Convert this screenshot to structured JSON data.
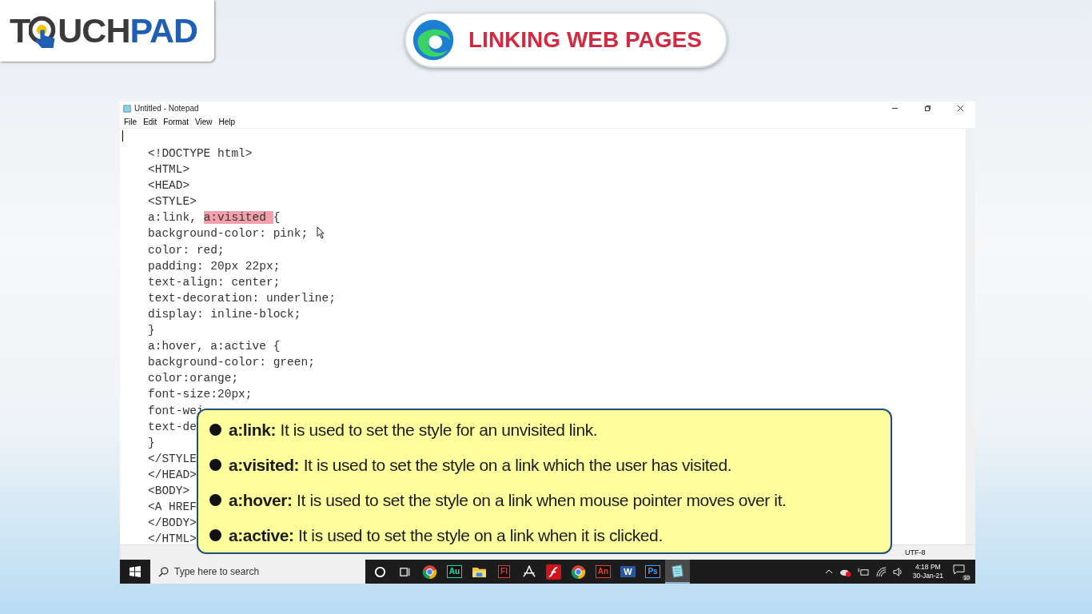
{
  "logo": {
    "start": "T",
    "middle": "UCH",
    "end": "PAD"
  },
  "banner": {
    "title": "LINKING WEB PAGES"
  },
  "window": {
    "title": "Untitled - Notepad",
    "menu": [
      "File",
      "Edit",
      "Format",
      "View",
      "Help"
    ],
    "lines": [
      {
        "text": "<!DOCTYPE html>"
      },
      {
        "text": "<HTML>"
      },
      {
        "text": "<HEAD>"
      },
      {
        "text": "<STYLE>"
      },
      {
        "parts": [
          {
            "text": "a:link, ",
            "selected": false
          },
          {
            "text": "a:visited ",
            "selected": true
          },
          {
            "text": "{",
            "selected": false
          }
        ]
      },
      {
        "text": "background-color: pink;"
      },
      {
        "text": "color: red;"
      },
      {
        "text": "padding: 20px 22px;"
      },
      {
        "text": "text-align: center;"
      },
      {
        "text": "text-decoration: underline;"
      },
      {
        "text": "display: inline-block;"
      },
      {
        "text": "}"
      },
      {
        "text": "a:hover, a:active {"
      },
      {
        "text": "background-color: green;"
      },
      {
        "text": "color:orange;"
      },
      {
        "text": "font-size:20px;"
      },
      {
        "text": "font-wei"
      },
      {
        "text": "text-de"
      },
      {
        "text": "}"
      },
      {
        "text": "</STYLE"
      },
      {
        "text": "</HEAD>"
      },
      {
        "text": "<BODY>"
      },
      {
        "text": "<A HREF"
      },
      {
        "text": "</BODY>"
      },
      {
        "text": "</HTML>"
      }
    ],
    "status": "UTF-8"
  },
  "callout": {
    "items": [
      {
        "text": "**a:link:** It is used to set the style for an unvisited link."
      },
      {
        "text": "**a:visited:** It is used to set the style on a link which the user has visited."
      },
      {
        "text": "**a:hover:** It is used to set the style on a link when mouse pointer moves over it."
      },
      {
        "text": "**a:active:** It is used to set the style on a link when it is clicked."
      }
    ]
  },
  "taskbar": {
    "search_placeholder": "Type here to search",
    "apps": [
      {
        "kind": "cortana",
        "selected": false
      },
      {
        "kind": "taskview",
        "selected": false
      },
      {
        "kind": "chrome",
        "selected": false
      },
      {
        "kind": "badge",
        "label": "Au",
        "color": "#00e4bb",
        "selected": false
      },
      {
        "kind": "folder",
        "selected": false
      },
      {
        "kind": "badge",
        "label": "Fl",
        "color": "#e03a3a",
        "selected": false
      },
      {
        "kind": "acrobat",
        "selected": false
      },
      {
        "kind": "flash",
        "selected": false
      },
      {
        "kind": "chrome",
        "selected": false
      },
      {
        "kind": "badge",
        "label": "An",
        "color": "#e0442a",
        "selected": false
      },
      {
        "kind": "word",
        "label": "W",
        "selected": false
      },
      {
        "kind": "badge",
        "label": "Ps",
        "color": "#31a8ff",
        "selected": false
      },
      {
        "kind": "notepad",
        "selected": true
      }
    ],
    "time": "4:18 PM",
    "date": "30-Jan-21",
    "notifications": "10"
  }
}
